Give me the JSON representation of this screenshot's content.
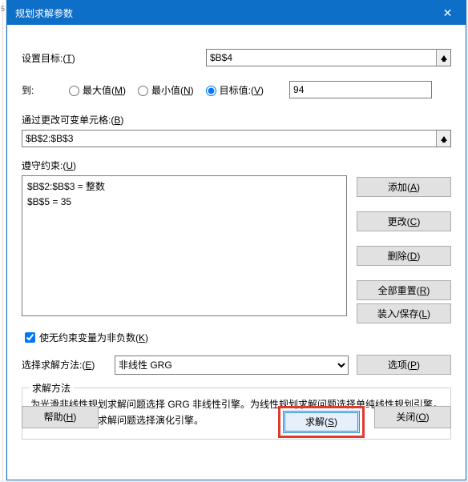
{
  "title": "规划求解参数",
  "labels": {
    "set_target_prefix": "设置目标:(",
    "set_target_key": "T",
    "close_paren": ")",
    "to": "到:",
    "radio_max_pre": "最大值(",
    "radio_max_key": "M",
    "radio_min_pre": "最小值(",
    "radio_min_key": "N",
    "radio_val_pre": "目标值:(",
    "radio_val_key": "V",
    "change_cells_pre": "通过更改可变单元格:(",
    "change_cells_key": "B",
    "constraints_pre": "遵守约束:(",
    "constraints_key": "U",
    "nonneg_pre": "使无约束变量为非负数(",
    "nonneg_key": "K",
    "method_pre": "选择求解方法:(",
    "method_key": "E",
    "group_legend": "求解方法",
    "group_desc": "为光滑非线性规划求解问题选择 GRG 非线性引擎。为线性规划求解问题选择单纯线性规划引擎，并为非光滑规划求解问题选择演化引擎。"
  },
  "inputs": {
    "target": "$B$4",
    "target_value": "94",
    "change_cells": "$B$2:$B$3",
    "method_selected": "非线性 GRG"
  },
  "constraints": [
    "$B$2:$B$3 = 整数",
    "$B$5 = 35"
  ],
  "buttons": {
    "add_pre": "添加(",
    "add_key": "A",
    "change_pre": "更改(",
    "change_key": "C",
    "delete_pre": "删除(",
    "delete_key": "D",
    "reset_pre": "全部重置(",
    "reset_key": "R",
    "save_pre": "装入/保存(",
    "save_key": "L",
    "options_pre": "选项(",
    "options_key": "P",
    "help_pre": "帮助(",
    "help_key": "H",
    "solve_pre": "求解(",
    "solve_key": "S",
    "close_pre": "关闭(",
    "close_key": "O"
  }
}
